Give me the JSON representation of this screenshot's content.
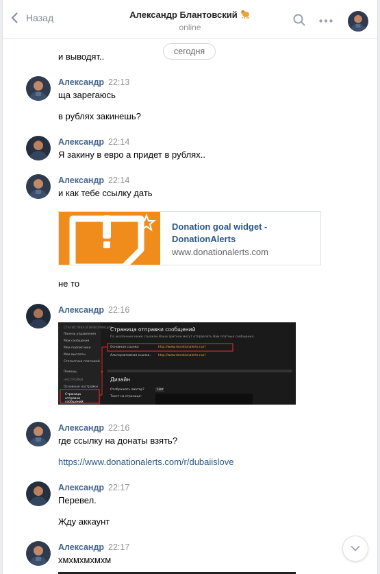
{
  "header": {
    "back_label": "Назад",
    "title": "Александр Блантовский",
    "status": "online",
    "icons": [
      "chevron-left-icon",
      "search-icon",
      "more-icon"
    ]
  },
  "date_divider": "сегодня",
  "messages": [
    {
      "text": "и выводят.."
    },
    {
      "author": "Александр",
      "time": "22:13",
      "lines": [
        "ща зарегаюсь",
        "в рублях закинешь?"
      ]
    },
    {
      "author": "Александр",
      "time": "22:14",
      "lines": [
        "Я закину в евро а придет в рублях.."
      ]
    },
    {
      "author": "Александр",
      "time": "22:14",
      "lines": [
        "и как тебе ссылку дать"
      ],
      "snippet": {
        "title": "Donation goal widget - DonationAlerts",
        "domain": "www.donationalerts.com"
      },
      "after": "не то"
    },
    {
      "author": "Александр",
      "time": "22:16",
      "screenshot": {
        "sidebar_items": [
          "СТАТИСТИКА И ИНФОРМАЦИЯ",
          "Панель управления",
          "Мои сообщения",
          "Мои подписчики",
          "Мои выплаты",
          "Статистика платежей",
          "Помощь",
          "НАСТРОЙКИ",
          "Основные настройки",
          "Страница отправки сообщений"
        ],
        "heading": "Страница отправки сообщений",
        "subtitle": "По указанным ниже ссылкам Ваши зрители могут отправлять Вам платные сообщения.",
        "main_label": "Основная ссылка:",
        "main_url": "http://www.donationalerts.ru/r/",
        "alt_label": "Альтернативная ссылка:",
        "alt_url": "http://www.donationalerts.ru/r/",
        "design": "Дизайн",
        "avatar_label": "Отображать аватар?",
        "avatar_value": "Нет",
        "page_text_label": "Текст на странице:"
      }
    },
    {
      "author": "Александр",
      "time": "22:16",
      "lines": [
        "где ссылку на донаты взять?"
      ],
      "link": "https://www.donationalerts.com/r/dubaiislove"
    },
    {
      "author": "Александр",
      "time": "22:17",
      "lines": [
        "Перевел.",
        "Жду аккаунт"
      ]
    },
    {
      "author": "Александр",
      "time": "22:17",
      "lines": [
        "хмхмхмхмхм"
      ]
    }
  ],
  "colors": {
    "accent": "#2a5885",
    "author": "#42648b",
    "donation_orange": "#f08c1c",
    "highlight_red": "#e0262c"
  }
}
